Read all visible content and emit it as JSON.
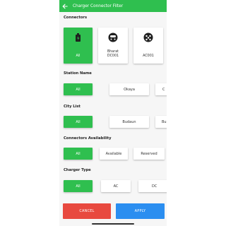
{
  "header": {
    "title": "Charger Connector Filter",
    "back_icon": "back-arrow-icon"
  },
  "connectors": {
    "title": "Connectors",
    "items": [
      {
        "label": "All",
        "icon": "plug-icon",
        "selected": true
      },
      {
        "label": "Bharat DC001",
        "icon": "dc-connector-icon",
        "selected": false
      },
      {
        "label": "AC001",
        "icon": "ac-connector-icon",
        "selected": false
      }
    ]
  },
  "station_name": {
    "title": "Station Name",
    "options": [
      "All",
      "Okaya",
      "C"
    ],
    "selected": "All"
  },
  "city_list": {
    "title": "City List",
    "options": [
      "All",
      "Budaun",
      "Bu"
    ],
    "selected": "All"
  },
  "availability": {
    "title": "Connectors Availability",
    "options": [
      "All",
      "Available",
      "Reserved"
    ],
    "selected": "All"
  },
  "charger_type": {
    "title": "Charger Type",
    "options": [
      "All",
      "AC",
      "DC"
    ],
    "selected": "All"
  },
  "actions": {
    "cancel_label": "CANCEL",
    "apply_label": "APPLY"
  },
  "colors": {
    "accent": "#2fbf4f",
    "cancel": "#e8493f",
    "apply": "#2b8ef0"
  }
}
